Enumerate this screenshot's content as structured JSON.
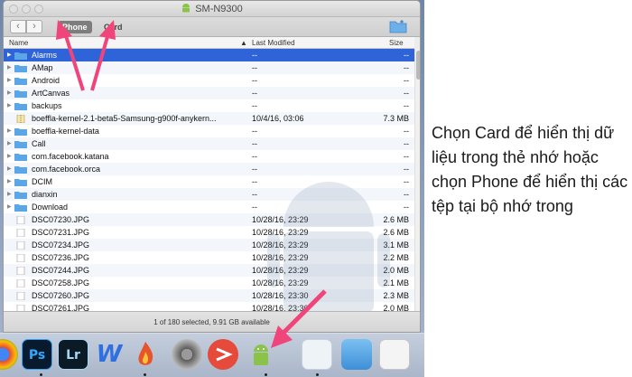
{
  "window": {
    "title": "SM-N9300",
    "tabs": {
      "phone": "Phone",
      "card": "Card"
    },
    "active_tab": "Phone"
  },
  "columns": {
    "name": "Name",
    "modified": "Last Modified",
    "size": "Size"
  },
  "files": [
    {
      "name": "Alarms",
      "modified": "--",
      "size": "--",
      "type": "folder",
      "selected": true
    },
    {
      "name": "AMap",
      "modified": "--",
      "size": "--",
      "type": "folder"
    },
    {
      "name": "Android",
      "modified": "--",
      "size": "--",
      "type": "folder"
    },
    {
      "name": "ArtCanvas",
      "modified": "--",
      "size": "--",
      "type": "folder"
    },
    {
      "name": "backups",
      "modified": "--",
      "size": "--",
      "type": "folder"
    },
    {
      "name": "boeffla-kernel-2.1-beta5-Samsung-g900f-anykern...",
      "modified": "10/4/16, 03:06",
      "size": "7.3 MB",
      "type": "archive"
    },
    {
      "name": "boeffla-kernel-data",
      "modified": "--",
      "size": "--",
      "type": "folder"
    },
    {
      "name": "Call",
      "modified": "--",
      "size": "--",
      "type": "folder"
    },
    {
      "name": "com.facebook.katana",
      "modified": "--",
      "size": "--",
      "type": "folder"
    },
    {
      "name": "com.facebook.orca",
      "modified": "--",
      "size": "--",
      "type": "folder"
    },
    {
      "name": "DCIM",
      "modified": "--",
      "size": "--",
      "type": "folder"
    },
    {
      "name": "dianxin",
      "modified": "--",
      "size": "--",
      "type": "folder"
    },
    {
      "name": "Download",
      "modified": "--",
      "size": "--",
      "type": "folder"
    },
    {
      "name": "DSC07230.JPG",
      "modified": "10/28/16, 23:29",
      "size": "2.6 MB",
      "type": "file"
    },
    {
      "name": "DSC07231.JPG",
      "modified": "10/28/16, 23:29",
      "size": "2.6 MB",
      "type": "file"
    },
    {
      "name": "DSC07234.JPG",
      "modified": "10/28/16, 23:29",
      "size": "3.1 MB",
      "type": "file"
    },
    {
      "name": "DSC07236.JPG",
      "modified": "10/28/16, 23:29",
      "size": "2.2 MB",
      "type": "file"
    },
    {
      "name": "DSC07244.JPG",
      "modified": "10/28/16, 23:29",
      "size": "2.0 MB",
      "type": "file"
    },
    {
      "name": "DSC07258.JPG",
      "modified": "10/28/16, 23:29",
      "size": "2.1 MB",
      "type": "file"
    },
    {
      "name": "DSC07260.JPG",
      "modified": "10/28/16, 23:30",
      "size": "2.3 MB",
      "type": "file"
    },
    {
      "name": "DSC07261.JPG",
      "modified": "10/28/16, 23:30",
      "size": "2.0 MB",
      "type": "file"
    }
  ],
  "status": "1 of 180 selected, 9.91 GB available",
  "dock": {
    "items": [
      {
        "name": "chrome-icon",
        "label": ""
      },
      {
        "name": "photoshop-icon",
        "label": "Ps"
      },
      {
        "name": "lightroom-icon",
        "label": "Lr"
      },
      {
        "name": "word-icon",
        "label": "W"
      },
      {
        "name": "flame-app-icon",
        "label": ""
      },
      {
        "name": "system-preferences-icon",
        "label": ""
      },
      {
        "name": "mindnode-icon",
        "label": ""
      },
      {
        "name": "android-file-transfer-icon",
        "label": ""
      },
      {
        "name": "document-icon",
        "label": ""
      },
      {
        "name": "folder-icon",
        "label": ""
      },
      {
        "name": "screenshot-icon",
        "label": ""
      }
    ]
  },
  "caption": "Chọn Card để hiển thị dữ liệu trong thẻ nhớ hoặc chọn Phone để hiển thị các tệp tại bộ nhớ trong",
  "colors": {
    "selection": "#2f64d8",
    "folder": "#5aa6e6",
    "arrow": "#f0457a",
    "android_green": "#8bc34a"
  }
}
